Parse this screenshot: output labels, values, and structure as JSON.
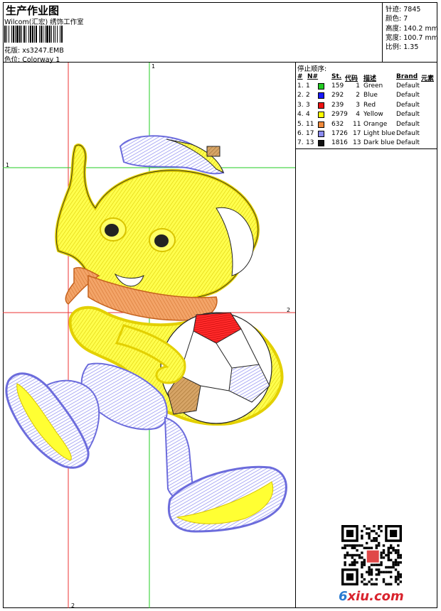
{
  "header": {
    "title": "生产作业图",
    "studio": "Wilcom(汇宏) 绣饰工作室",
    "design_label": "花版:",
    "design_value": "xs3247.EMB",
    "colorway_label": "色位:",
    "colorway_value": "Colorway 1"
  },
  "stats": [
    {
      "label": "针迹:",
      "value": "7845"
    },
    {
      "label": "颜色:",
      "value": "7"
    },
    {
      "label": "高度:",
      "value": "140.2 mm"
    },
    {
      "label": "宽度:",
      "value": "100.7 mm"
    },
    {
      "label": "比例:",
      "value": "1.35"
    }
  ],
  "stop_sequence": {
    "title": "停止顺序:",
    "headers": [
      "#",
      "N#",
      "St.",
      "代码",
      "描述",
      "Brand",
      "元素"
    ],
    "rows": [
      {
        "idx": "1.",
        "n": "1",
        "st": "159",
        "code": "1",
        "desc": "Green",
        "brand": "Default",
        "color": "#22cc22"
      },
      {
        "idx": "2.",
        "n": "2",
        "st": "292",
        "code": "2",
        "desc": "Blue",
        "brand": "Default",
        "color": "#1a1aff"
      },
      {
        "idx": "3.",
        "n": "3",
        "st": "239",
        "code": "3",
        "desc": "Red",
        "brand": "Default",
        "color": "#ee1111"
      },
      {
        "idx": "4.",
        "n": "4",
        "st": "2979",
        "code": "4",
        "desc": "Yellow",
        "brand": "Default",
        "color": "#ffff00"
      },
      {
        "idx": "5.",
        "n": "11",
        "st": "632",
        "code": "11",
        "desc": "Orange",
        "brand": "Default",
        "color": "#f08a3c"
      },
      {
        "idx": "6.",
        "n": "17",
        "st": "1726",
        "code": "17",
        "desc": "Light blue",
        "brand": "Default",
        "color": "#8b8bf0"
      },
      {
        "idx": "7.",
        "n": "13",
        "st": "1816",
        "code": "13",
        "desc": "Dark blue",
        "brand": "Default",
        "color": "#111111"
      }
    ]
  },
  "guides": {
    "marker_1": "1",
    "marker_2": "2"
  },
  "watermark": {
    "brand": "6xiu.com",
    "brand_prefix": "6",
    "brand_rest": "xiu.com"
  },
  "icons": {
    "qr": "qr-code-icon"
  }
}
